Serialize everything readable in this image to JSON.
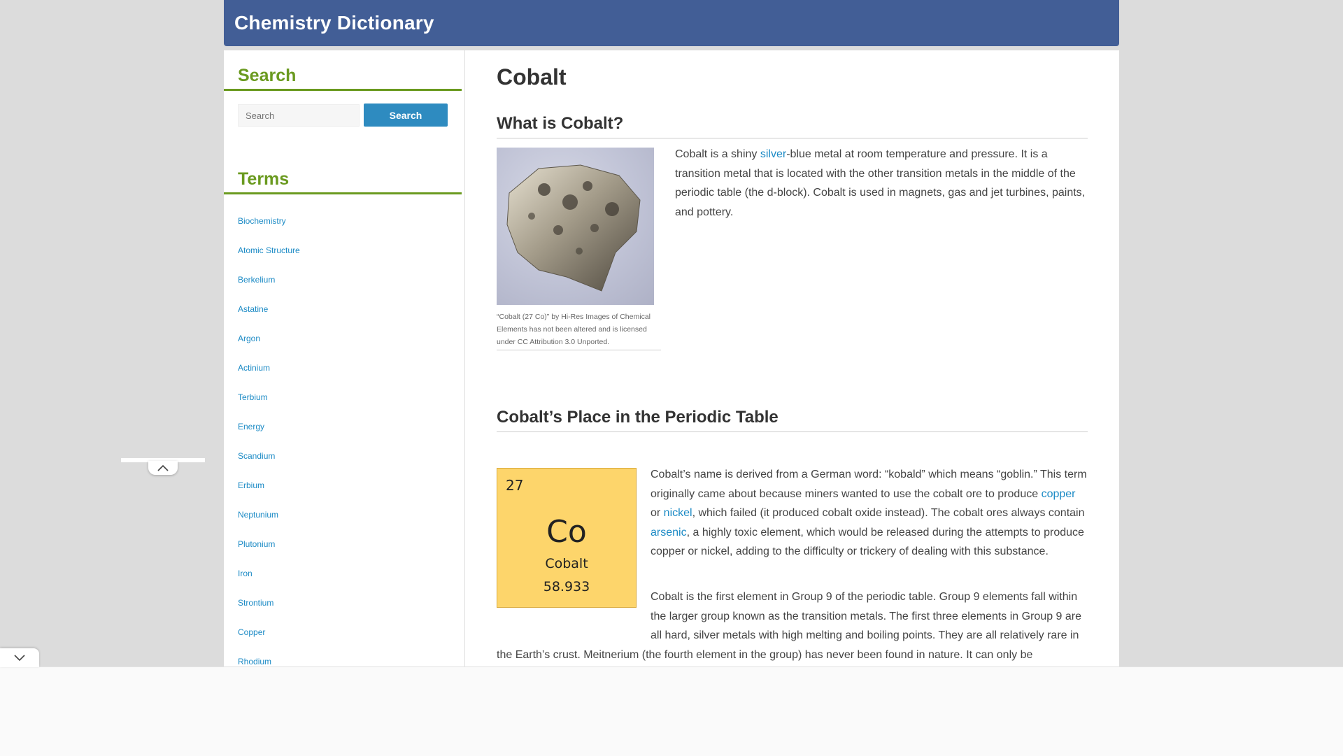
{
  "header": {
    "site_title": "Chemistry Dictionary"
  },
  "sidebar": {
    "search_heading": "Search",
    "search_placeholder": "Search",
    "search_button": "Search",
    "terms_heading": "Terms",
    "terms": [
      "Biochemistry",
      "Atomic Structure",
      "Berkelium",
      "Astatine",
      "Argon",
      "Actinium",
      "Terbium",
      "Energy",
      "Scandium",
      "Erbium",
      "Neptunium",
      "Plutonium",
      "Iron",
      "Strontium",
      "Copper",
      "Rhodium"
    ]
  },
  "article": {
    "title": "Cobalt",
    "section1_heading": "What is Cobalt?",
    "image_caption": "“Cobalt (27 Co)” by Hi-Res Images of Chemical Elements has not been altered and is licensed under CC Attribution 3.0 Unported.",
    "para1": {
      "before_link": "Cobalt is a shiny ",
      "link_silver": "silver",
      "after_link": "-blue metal at room temperature and pressure.  It is a transition metal that is located with the other transition metals in the middle of the periodic table (the d-block). Cobalt is used in magnets, gas and jet turbines, paints, and pottery."
    },
    "section2_heading": "Cobalt’s Place in the Periodic Table",
    "element_tile": {
      "number": "27",
      "symbol": "Co",
      "name": "Cobalt",
      "mass": "58.933"
    },
    "para2": {
      "part1": "Cobalt’s name is derived from a German word: “kobald” which means “goblin.” This term originally came about because miners wanted to use the cobalt ore to produce ",
      "link_copper": "copper",
      "part2": " or ",
      "link_nickel": "nickel",
      "part3": ", which failed (it produced cobalt oxide instead). The cobalt ores always contain ",
      "link_arsenic": "arsenic",
      "part4": ", a highly toxic element, which would be released during the attempts to produce copper or nickel, adding to the difficulty or trickery of dealing with this substance."
    },
    "para3": "Cobalt is the first element in Group 9 of the periodic table. Group 9 elements fall within the larger group known as the transition metals. The first three elements in Group 9 are all hard, silver metals with high melting and boiling points. They are all relatively rare in the Earth’s crust. Meitnerium (the fourth element in the group) has never been found in nature. It can only be synthesized using nuclear reactors."
  },
  "icons": {
    "scroll_up": "chevron-up-icon",
    "collapse": "chevron-down-icon"
  },
  "colors": {
    "header": "#425e96",
    "accent_green": "#6a9a1f",
    "link": "#1b8ac5",
    "button": "#2e8bc0",
    "tile": "#fdd56b"
  }
}
